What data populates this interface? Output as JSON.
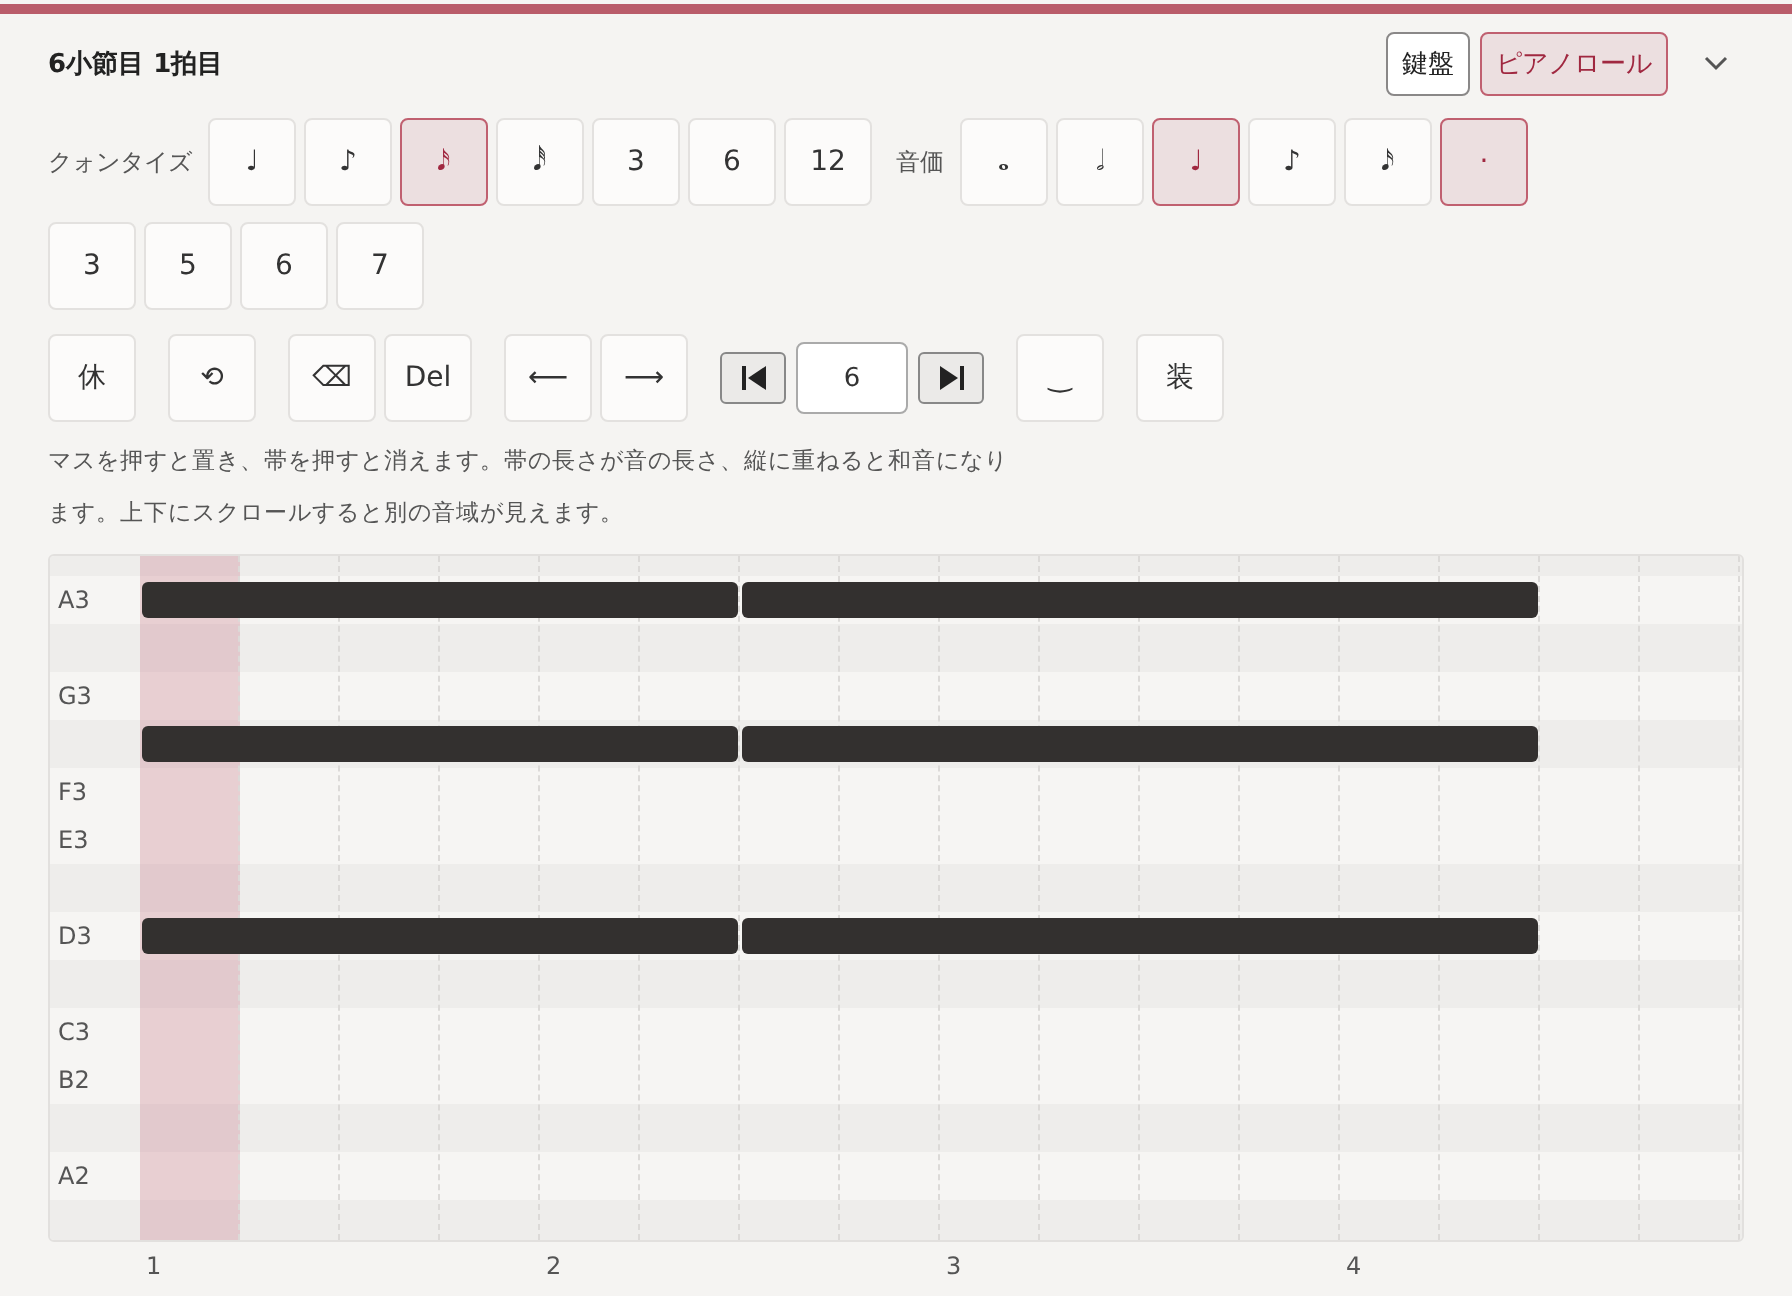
{
  "title": "6小節目 1拍目",
  "view_tabs": [
    {
      "label": "鍵盤",
      "selected": false
    },
    {
      "label": "ピアノロール",
      "selected": true
    }
  ],
  "button_groups": [
    {
      "label": "クォンタイズ",
      "buttons": [
        {
          "text": "♩",
          "selected": false
        },
        {
          "text": "♪",
          "selected": false
        },
        {
          "text": "𝅘𝅥𝅯",
          "selected": true
        },
        {
          "text": "𝅘𝅥𝅰",
          "selected": false
        },
        {
          "text": "3",
          "selected": false
        },
        {
          "text": "6",
          "selected": false
        },
        {
          "text": "12",
          "selected": false
        }
      ]
    },
    {
      "label": "音価",
      "buttons": [
        {
          "text": "𝅝",
          "selected": false
        },
        {
          "text": "𝅗𝅥",
          "selected": false
        },
        {
          "text": "♩",
          "selected": true
        },
        {
          "text": "♪",
          "selected": false
        },
        {
          "text": "𝅘𝅥𝅯",
          "selected": false
        },
        {
          "text": "·",
          "selected": true
        }
      ]
    },
    {
      "buttons": [
        {
          "text": "3",
          "selected": false
        },
        {
          "text": "5",
          "selected": false
        },
        {
          "text": "6",
          "selected": false
        },
        {
          "text": "7",
          "selected": false
        }
      ]
    }
  ],
  "toolbar": [
    {
      "kind": "buttons",
      "buttons": [
        "休"
      ]
    },
    {
      "kind": "buttons",
      "buttons": [
        "⟲"
      ]
    },
    {
      "kind": "buttons",
      "buttons": [
        "⌫",
        "Del"
      ]
    },
    {
      "kind": "buttons",
      "buttons": [
        "⟵",
        "⟶"
      ]
    },
    {
      "kind": "stepper",
      "value": "6"
    },
    {
      "kind": "buttons",
      "buttons": [
        "‿"
      ]
    },
    {
      "kind": "buttons",
      "buttons": [
        "装"
      ]
    }
  ],
  "help_text": "マスを押すと置き、帯を押すと消えます。帯の長さが音の長さ、縦に重ねると和音になります。上下にスクロールすると別の音域が見えます。",
  "piano_roll": {
    "steps": [
      {
        "selected": true
      },
      {
        "selected": false
      },
      {
        "selected": false
      },
      {
        "selected": false
      },
      {
        "selected": false
      },
      {
        "selected": false
      },
      {
        "selected": false
      },
      {
        "selected": false
      },
      {
        "selected": false
      },
      {
        "selected": false
      },
      {
        "selected": false
      },
      {
        "selected": false
      },
      {
        "selected": false
      },
      {
        "selected": false
      },
      {
        "selected": false
      },
      {
        "selected": false
      }
    ],
    "rows": [
      {
        "kind": "black"
      },
      {
        "kind": "white",
        "label": "A3",
        "cells": [
          {
            "kind": "head"
          },
          {
            "kind": "body"
          },
          {
            "kind": "body"
          },
          {
            "kind": "body"
          },
          {
            "kind": "body"
          },
          {
            "kind": "tail"
          },
          {
            "kind": "head"
          },
          {
            "kind": "body"
          },
          {
            "kind": "body"
          },
          {
            "kind": "body"
          },
          {
            "kind": "body"
          },
          {
            "kind": "body"
          },
          {
            "kind": "body"
          },
          {
            "kind": "tail"
          },
          {
            "kind": "empty"
          },
          {
            "kind": "empty"
          }
        ]
      },
      {
        "kind": "black"
      },
      {
        "kind": "white",
        "label": "G3"
      },
      {
        "kind": "black",
        "cells": [
          {
            "kind": "head"
          },
          {
            "kind": "body"
          },
          {
            "kind": "body"
          },
          {
            "kind": "body"
          },
          {
            "kind": "body"
          },
          {
            "kind": "tail"
          },
          {
            "kind": "head"
          },
          {
            "kind": "body"
          },
          {
            "kind": "body"
          },
          {
            "kind": "body"
          },
          {
            "kind": "body"
          },
          {
            "kind": "body"
          },
          {
            "kind": "body"
          },
          {
            "kind": "tail"
          },
          {
            "kind": "empty"
          },
          {
            "kind": "empty"
          }
        ]
      },
      {
        "kind": "white",
        "label": "F3"
      },
      {
        "kind": "white",
        "label": "E3"
      },
      {
        "kind": "black"
      },
      {
        "kind": "white",
        "label": "D3",
        "cells": [
          {
            "kind": "head"
          },
          {
            "kind": "body"
          },
          {
            "kind": "body"
          },
          {
            "kind": "body"
          },
          {
            "kind": "body"
          },
          {
            "kind": "tail"
          },
          {
            "kind": "head"
          },
          {
            "kind": "body"
          },
          {
            "kind": "body"
          },
          {
            "kind": "body"
          },
          {
            "kind": "body"
          },
          {
            "kind": "body"
          },
          {
            "kind": "body"
          },
          {
            "kind": "tail"
          },
          {
            "kind": "empty"
          },
          {
            "kind": "empty"
          }
        ]
      },
      {
        "kind": "black"
      },
      {
        "kind": "white",
        "label": "C3"
      },
      {
        "kind": "white",
        "label": "B2"
      },
      {
        "kind": "black"
      },
      {
        "kind": "white",
        "label": "A2"
      },
      {
        "kind": "black"
      }
    ],
    "beats": [
      "1",
      "2",
      "3",
      "4"
    ]
  }
}
